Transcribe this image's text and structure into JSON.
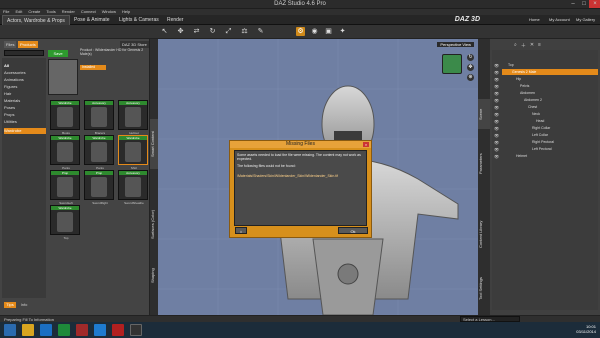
{
  "window": {
    "title": "DAZ Studio 4.6 Pro"
  },
  "menu": [
    "File",
    "Edit",
    "Create",
    "Tools",
    "Render",
    "Connect",
    "Window",
    "Help"
  ],
  "main_tabs": [
    "Actors, Wardrobe & Props",
    "Pose & Animate",
    "Lights & Cameras",
    "Render"
  ],
  "brand": {
    "logo": "DAZ 3D",
    "links": [
      "Home",
      "My Account",
      "My Gallery"
    ]
  },
  "left_panel": {
    "tabs": [
      "Files",
      "Products"
    ],
    "store_label": "DAZ 3D Store",
    "all_label": "All",
    "categories": [
      "Accessories",
      "Animations",
      "Figures",
      "Hair",
      "Materials",
      "Poses",
      "Props",
      "Utilities",
      "Wardrobe"
    ],
    "selected_category": "Wardrobe",
    "product_title": "Product : Wildenlander HD for Genesis 2 Male(s)",
    "save_label": "Save",
    "installed_label": "Installed",
    "thumbs": [
      {
        "badge": "Wardrobe",
        "label": "Boots",
        "color": "#3a8a2a"
      },
      {
        "badge": "Accessory",
        "label": "Bracers",
        "color": "#3a8a2a"
      },
      {
        "badge": "Accessory",
        "label": "Helmet",
        "color": "#3a8a2a"
      },
      {
        "badge": "Wardrobe",
        "label": "Pants",
        "color": "#3a8a2a"
      },
      {
        "badge": "Wardrobe",
        "label": "Pants",
        "color": "#3a8a2a"
      },
      {
        "badge": "Wardrobe",
        "label": "Shirt",
        "color": "#3a8a2a"
      },
      {
        "badge": "Prop",
        "label": "SwordLeft",
        "color": "#3a8a2a"
      },
      {
        "badge": "Prop",
        "label": "SwordRight",
        "color": "#3a8a2a"
      },
      {
        "badge": "Accessory",
        "label": "SwordSheathe",
        "color": "#3a8a2a"
      },
      {
        "badge": "Wardrobe",
        "label": "Top",
        "color": "#3a8a2a"
      }
    ],
    "bottom_tabs": [
      "Tips",
      "Info"
    ]
  },
  "left_vert_tabs": [
    "Smart Content",
    "Surfaces (Color)",
    "Shaping"
  ],
  "right_vert_tabs": [
    "Scene",
    "Parameters",
    "Content Library",
    "Tool Settings"
  ],
  "viewport": {
    "camera_label": "Perspective View"
  },
  "scene_nodes": [
    {
      "label": "Top",
      "indent": 0
    },
    {
      "label": "Genesis 2 Male",
      "indent": 1,
      "selected": true
    },
    {
      "label": "Hip",
      "indent": 2
    },
    {
      "label": "Pelvis",
      "indent": 3
    },
    {
      "label": "Abdomen",
      "indent": 3
    },
    {
      "label": "Abdomen 2",
      "indent": 4
    },
    {
      "label": "Chest",
      "indent": 5
    },
    {
      "label": "Neck",
      "indent": 6
    },
    {
      "label": "Head",
      "indent": 7
    },
    {
      "label": "Right Collar",
      "indent": 6
    },
    {
      "label": "Left Collar",
      "indent": 6
    },
    {
      "label": "Right Pectoral",
      "indent": 6
    },
    {
      "label": "Left Pectoral",
      "indent": 6
    },
    {
      "label": "Helmet",
      "indent": 2
    }
  ],
  "dialog": {
    "title": "Missing Files",
    "message": "Some assets needed to load the file were missing. The content may not work as expected.",
    "sub": "The following files could not be found:",
    "path": "/Materials/Shaders/Skin/Wildenlander_Skin/Wildenlander_Skin.tif",
    "ok_label": "Ok"
  },
  "status": {
    "text": "Preparing Fill To Information",
    "lesson": "Select a Lesson..."
  },
  "taskbar": {
    "time": "10:01",
    "date": "03/11/2014"
  }
}
